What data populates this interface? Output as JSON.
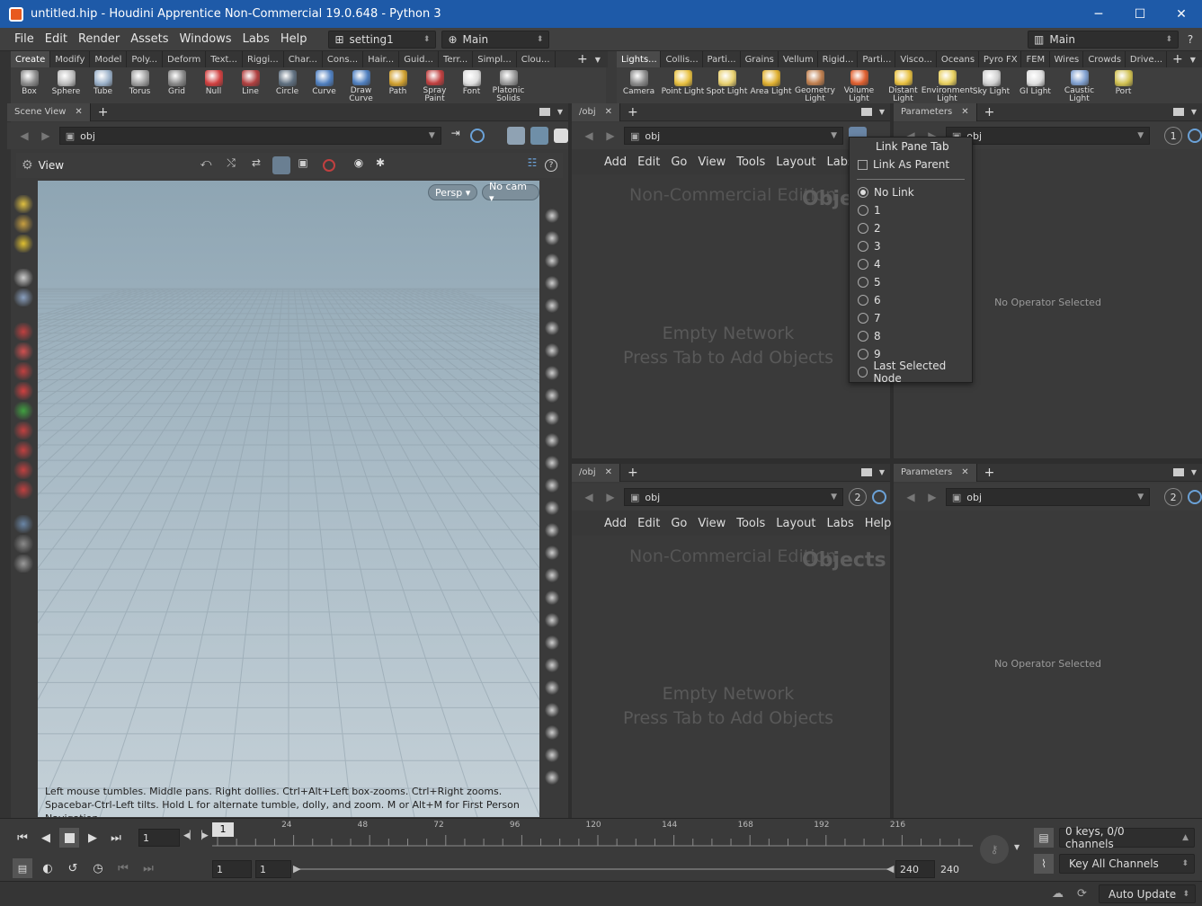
{
  "window": {
    "title": "untitled.hip - Houdini Apprentice Non-Commercial 19.0.648 - Python 3",
    "minimize": "─",
    "maximize": "☐",
    "close": "✕"
  },
  "menu": {
    "items": [
      "File",
      "Edit",
      "Render",
      "Assets",
      "Windows",
      "Labs",
      "Help"
    ],
    "desktop": "setting1",
    "context": "Main",
    "right_desk": "Main",
    "help": "?"
  },
  "shelf_left": {
    "tabs": [
      "Create",
      "Modify",
      "Model",
      "Poly...",
      "Deform",
      "Text...",
      "Riggi...",
      "Char...",
      "Cons...",
      "Hair...",
      "Guid...",
      "Terr...",
      "Simpl...",
      "Clou..."
    ],
    "tools": [
      {
        "label": "Box",
        "color": "#8a8a8a"
      },
      {
        "label": "Sphere",
        "color": "#bdbdbd"
      },
      {
        "label": "Tube",
        "color": "#9ab0c8"
      },
      {
        "label": "Torus",
        "color": "#a0a0a0"
      },
      {
        "label": "Grid",
        "color": "#888888"
      },
      {
        "label": "Null",
        "color": "#d04040"
      },
      {
        "label": "Line",
        "color": "#b04040"
      },
      {
        "label": "Circle",
        "color": "#607080"
      },
      {
        "label": "Curve",
        "color": "#5080c0"
      },
      {
        "label": "Draw Curve",
        "color": "#5080c0"
      },
      {
        "label": "Path",
        "color": "#d0a030"
      },
      {
        "label": "Spray Paint",
        "color": "#c04040"
      },
      {
        "label": "Font",
        "color": "#dddddd"
      },
      {
        "label": "Platonic Solids",
        "color": "#999999"
      }
    ]
  },
  "shelf_right": {
    "tabs": [
      "Lights...",
      "Collis...",
      "Parti...",
      "Grains",
      "Vellum",
      "Rigid...",
      "Parti...",
      "Visco...",
      "Oceans",
      "Pyro FX",
      "FEM",
      "Wires",
      "Crowds",
      "Drive..."
    ],
    "tools": [
      {
        "label": "Camera",
        "color": "#8a8a8a"
      },
      {
        "label": "Point Light",
        "color": "#e8c040"
      },
      {
        "label": "Spot Light",
        "color": "#e8d070"
      },
      {
        "label": "Area Light",
        "color": "#e0b030"
      },
      {
        "label": "Geometry Light",
        "color": "#c08050"
      },
      {
        "label": "Volume Light",
        "color": "#e06030"
      },
      {
        "label": "Distant Light",
        "color": "#e8c040"
      },
      {
        "label": "Environment Light",
        "color": "#e8d060"
      },
      {
        "label": "Sky Light",
        "color": "#d0d0d0"
      },
      {
        "label": "GI Light",
        "color": "#dddddd"
      },
      {
        "label": "Caustic Light",
        "color": "#80a0d0"
      },
      {
        "label": "Port",
        "color": "#d0c050"
      }
    ]
  },
  "scene_view": {
    "tab": "Scene View",
    "path": "obj",
    "view_label": "View",
    "persp": "Persp ▾",
    "cam": "No cam ▾",
    "hint": "Left mouse tumbles. Middle pans. Right dollies. Ctrl+Alt+Left box-zooms. Ctrl+Right zooms. Spacebar-Ctrl-Left tilts. Hold L for alternate tumble, dolly, and zoom.    M or Alt+M for First Person Navigation."
  },
  "net_top": {
    "tab": "/obj",
    "path": "obj",
    "watermark": "Non-Commercial Edition",
    "context": "Objects",
    "empty1": "Empty Network",
    "empty2": "Press Tab to Add Objects",
    "menu": [
      "Add",
      "Edit",
      "Go",
      "View",
      "Tools",
      "Layout",
      "Labs"
    ]
  },
  "net_bottom": {
    "tab": "/obj",
    "path": "obj",
    "link": "2",
    "watermark": "Non-Commercial Edition",
    "context": "Objects",
    "empty1": "Empty Network",
    "empty2": "Press Tab to Add Objects",
    "menu": [
      "Add",
      "Edit",
      "Go",
      "View",
      "Tools",
      "Layout",
      "Labs",
      "Help"
    ]
  },
  "params_top": {
    "tab": "Parameters",
    "path": "obj",
    "link": "1",
    "empty": "No Operator Selected"
  },
  "params_bottom": {
    "tab": "Parameters",
    "path": "obj",
    "link": "2",
    "empty": "No Operator Selected"
  },
  "popup": {
    "title": "Link Pane Tab",
    "link_parent": "Link As Parent",
    "options": [
      "No Link",
      "1",
      "2",
      "3",
      "4",
      "5",
      "6",
      "7",
      "8",
      "9",
      "Last Selected Node"
    ],
    "selected": "No Link"
  },
  "timeline": {
    "frame": "1",
    "ticks": [
      "24",
      "48",
      "72",
      "96",
      "120",
      "144",
      "168",
      "192",
      "216"
    ],
    "current_marker": "1",
    "range_start": "1",
    "range_start2": "1",
    "range_end": "240",
    "range_end2": "240",
    "keys": "0 keys, 0/0 channels",
    "key_mode": "Key All Channels"
  },
  "status": {
    "auto_update": "Auto Update"
  }
}
